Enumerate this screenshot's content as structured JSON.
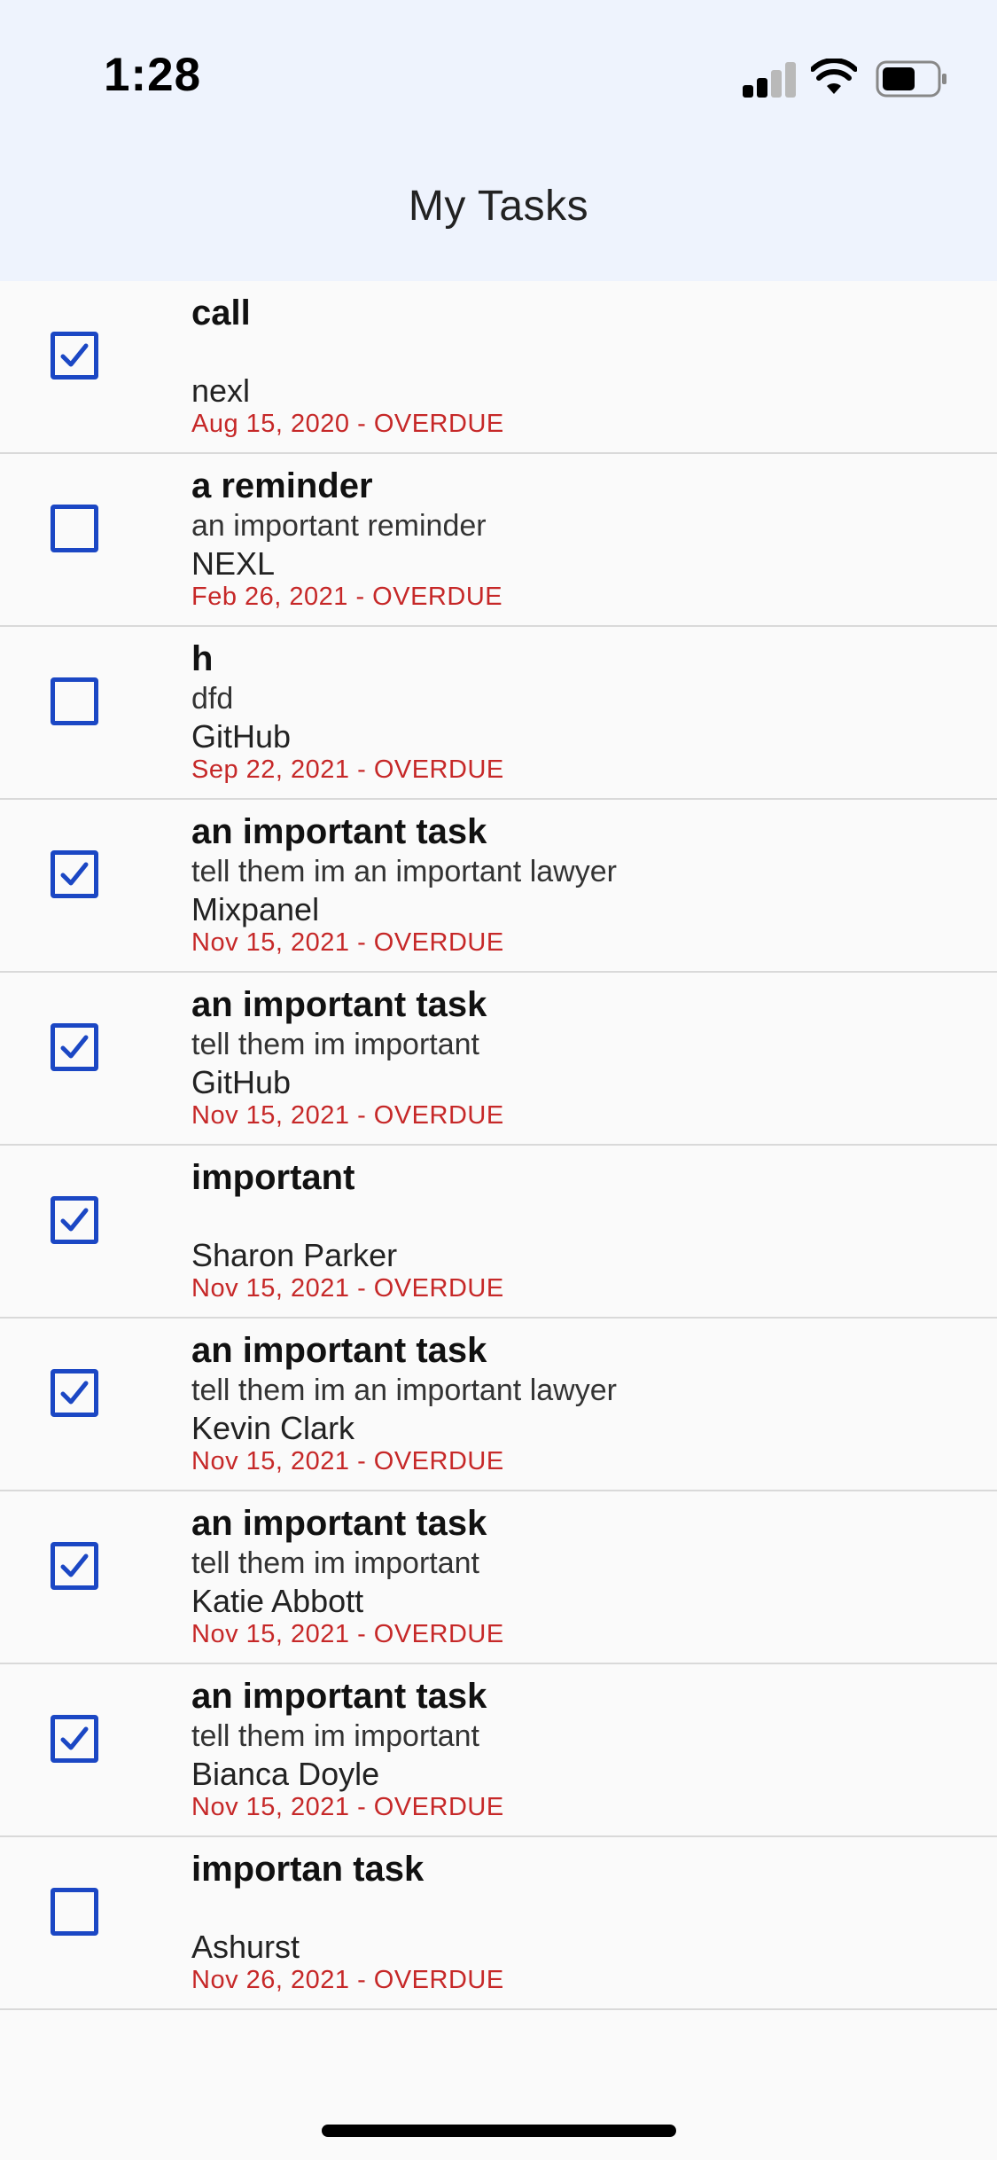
{
  "status_bar": {
    "time": "1:28"
  },
  "header": {
    "title": "My Tasks"
  },
  "colors": {
    "accent": "#1b47c4",
    "overdue": "#c62828",
    "header_bg": "#eef3fd"
  },
  "tasks": [
    {
      "title": "call",
      "description": "",
      "contact": "nexl",
      "due": "Aug 15, 2020 - OVERDUE",
      "checked": true
    },
    {
      "title": "a reminder",
      "description": "an important reminder",
      "contact": "NEXL",
      "due": "Feb 26, 2021 - OVERDUE",
      "checked": false
    },
    {
      "title": "h",
      "description": "dfd",
      "contact": "GitHub",
      "due": "Sep 22, 2021 - OVERDUE",
      "checked": false
    },
    {
      "title": "an important task",
      "description": "tell them im an important lawyer",
      "contact": "Mixpanel",
      "due": "Nov 15, 2021 - OVERDUE",
      "checked": true
    },
    {
      "title": "an important task",
      "description": "tell them im important",
      "contact": "GitHub",
      "due": "Nov 15, 2021 - OVERDUE",
      "checked": true
    },
    {
      "title": "important",
      "description": "",
      "contact": "Sharon Parker",
      "due": "Nov 15, 2021 - OVERDUE",
      "checked": true
    },
    {
      "title": "an important task",
      "description": "tell them im an important lawyer",
      "contact": "Kevin Clark",
      "due": "Nov 15, 2021 - OVERDUE",
      "checked": true
    },
    {
      "title": "an important task",
      "description": "tell them im important",
      "contact": "Katie Abbott",
      "due": "Nov 15, 2021 - OVERDUE",
      "checked": true
    },
    {
      "title": "an important task",
      "description": "tell them im important",
      "contact": "Bianca Doyle",
      "due": "Nov 15, 2021 - OVERDUE",
      "checked": true
    },
    {
      "title": "importan task",
      "description": "",
      "contact": "Ashurst",
      "due": "Nov 26, 2021 - OVERDUE",
      "checked": false
    }
  ]
}
